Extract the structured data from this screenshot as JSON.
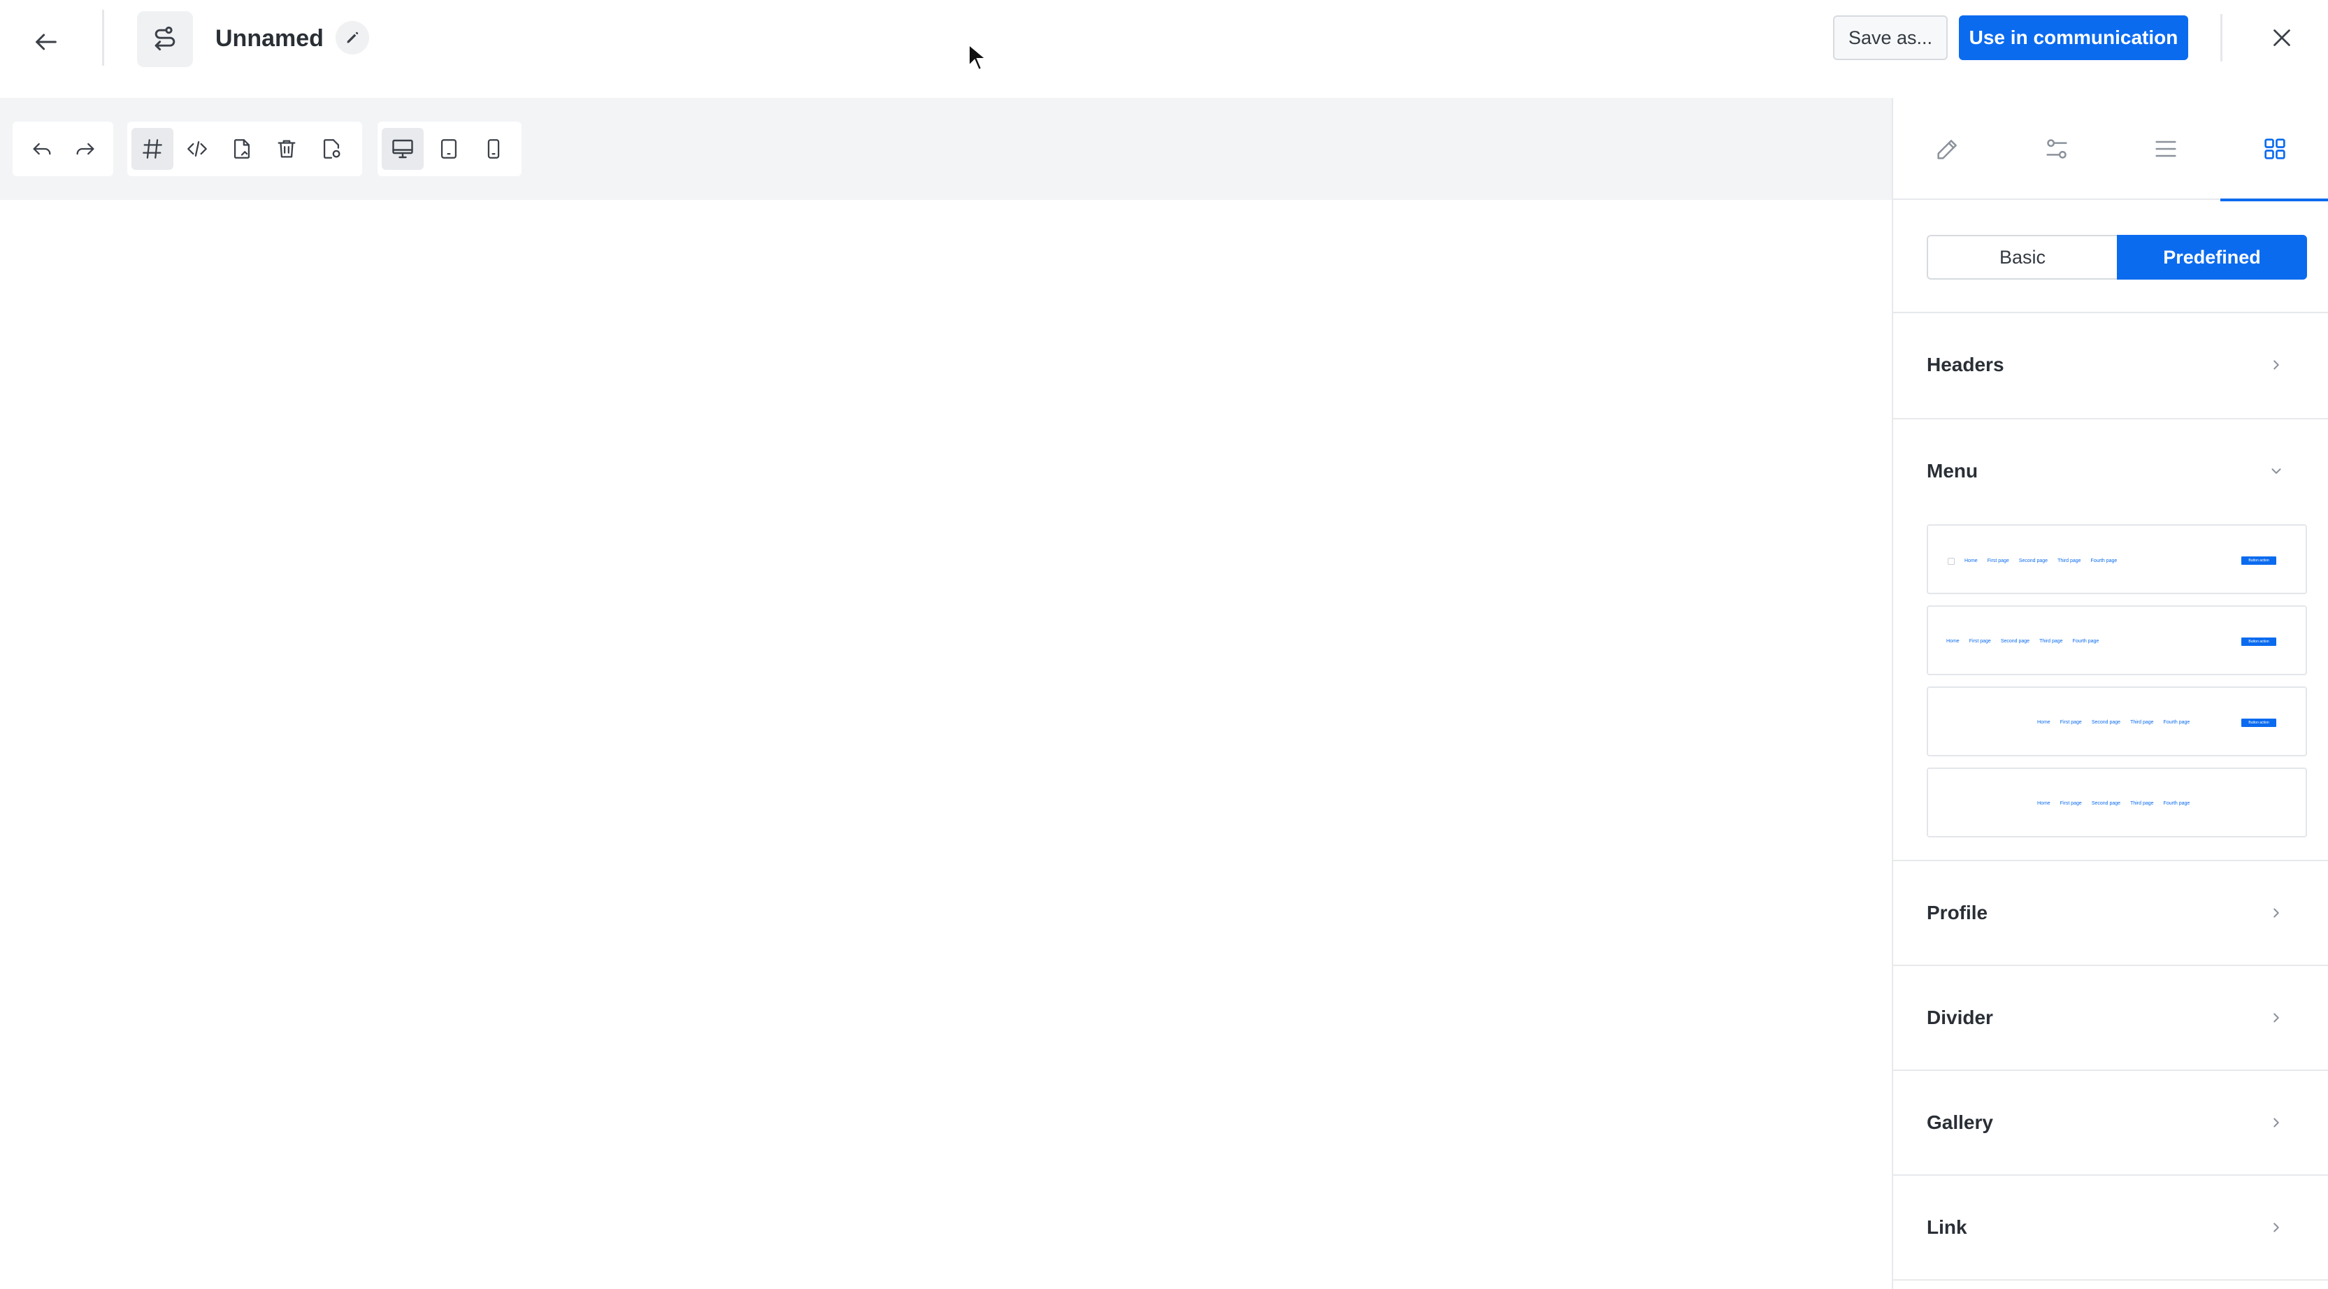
{
  "header": {
    "title": "Unnamed",
    "save_as_label": "Save as...",
    "use_label": "Use in communication",
    "icons": {
      "back": "arrow-left-icon",
      "app": "flow-icon",
      "edit": "pencil-icon",
      "close": "close-icon"
    }
  },
  "toolbar": {
    "history": [
      "undo-icon",
      "redo-icon"
    ],
    "tools": [
      "hash-icon",
      "code-icon",
      "document-edit-icon",
      "trash-icon",
      "document-settings-icon"
    ],
    "devices": [
      "desktop-icon",
      "tablet-icon",
      "mobile-icon"
    ],
    "active": [
      "hash-icon",
      "desktop-icon"
    ]
  },
  "panel": {
    "tabs": [
      "pencil-icon",
      "sliders-icon",
      "list-icon",
      "grid-icon"
    ],
    "active_tab": "grid-icon",
    "segment": {
      "basic": "Basic",
      "predefined": "Predefined",
      "selected": "Predefined"
    },
    "sections": [
      {
        "label": "Headers",
        "expanded": false
      },
      {
        "label": "Menu",
        "expanded": true
      },
      {
        "label": "Profile",
        "expanded": false
      },
      {
        "label": "Divider",
        "expanded": false
      },
      {
        "label": "Gallery",
        "expanded": false
      },
      {
        "label": "Link",
        "expanded": false
      }
    ],
    "menu_thumbnails": [
      {
        "items": [
          "Home",
          "First page",
          "Second page",
          "Third page",
          "Fourth page"
        ],
        "cta": "Button action",
        "logo": true
      },
      {
        "items": [
          "Home",
          "First page",
          "Second page",
          "Third page",
          "Fourth page"
        ],
        "cta": "Button action",
        "logo": false
      },
      {
        "items": [
          "Home",
          "First page",
          "Second page",
          "Third page",
          "Fourth page"
        ],
        "cta": "Button action",
        "logo": false
      },
      {
        "items": [
          "Home",
          "First page",
          "Second page",
          "Third page",
          "Fourth page"
        ],
        "cta": "",
        "logo": false
      }
    ]
  },
  "colors": {
    "accent": "#0b6bef",
    "toolbar_bg": "#f3f4f6",
    "border": "#e7e9ec",
    "text": "#2a2f36"
  }
}
